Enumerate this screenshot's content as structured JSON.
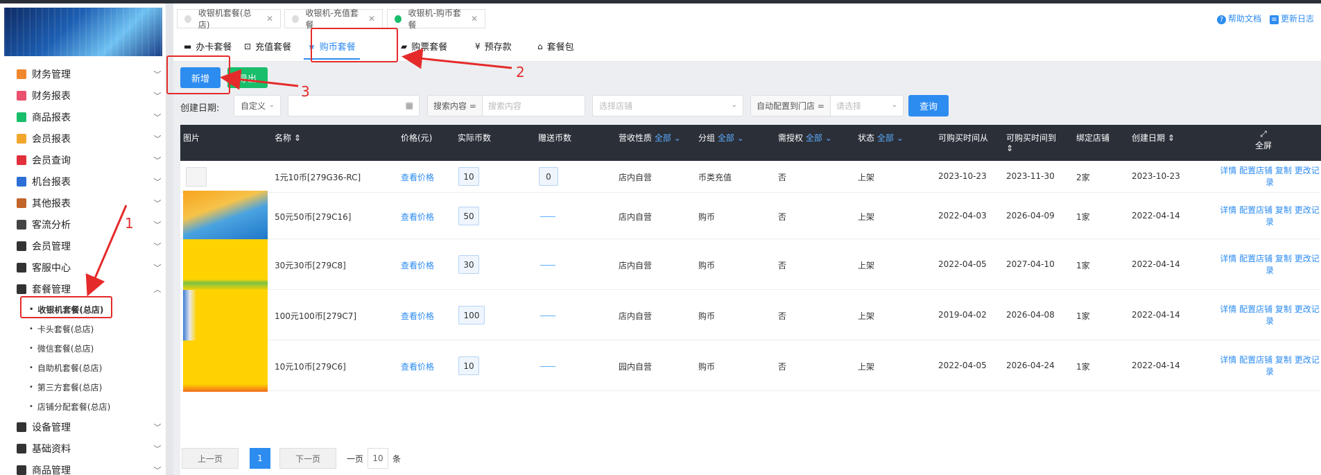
{
  "sidebar": {
    "menu": [
      {
        "label": "财务管理",
        "icon": "finance-icon",
        "color": "#f0872d",
        "expanded": false
      },
      {
        "label": "财务报表",
        "icon": "finance-report-icon",
        "color": "#e9516f",
        "expanded": false
      },
      {
        "label": "商品报表",
        "icon": "goods-report-icon",
        "color": "#19be6b",
        "expanded": false
      },
      {
        "label": "会员报表",
        "icon": "member-report-icon",
        "color": "#f2a72c",
        "expanded": false
      },
      {
        "label": "会员查询",
        "icon": "member-query-icon",
        "color": "#e0303c",
        "expanded": false
      },
      {
        "label": "机台报表",
        "icon": "machine-report-icon",
        "color": "#2d6fd6",
        "expanded": false
      },
      {
        "label": "其他报表",
        "icon": "other-report-icon",
        "color": "#c2652a",
        "expanded": false
      },
      {
        "label": "客流分析",
        "icon": "traffic-analysis-icon",
        "color": "#444",
        "expanded": false
      },
      {
        "label": "会员管理",
        "icon": "member-manage-icon",
        "color": "#333",
        "expanded": false
      },
      {
        "label": "客服中心",
        "icon": "headset-icon",
        "color": "#333",
        "expanded": false
      },
      {
        "label": "套餐管理",
        "icon": "package-manage-icon",
        "color": "#333",
        "expanded": true
      }
    ],
    "submenu": [
      "收银机套餐(总店)",
      "卡头套餐(总店)",
      "微信套餐(总店)",
      "自助机套餐(总店)",
      "第三方套餐(总店)",
      "店铺分配套餐(总店)"
    ],
    "menu_after": [
      {
        "label": "设备管理",
        "icon": "device-manage-icon",
        "color": "#333"
      },
      {
        "label": "基础资料",
        "icon": "basic-data-icon",
        "color": "#333"
      },
      {
        "label": "商品管理",
        "icon": "goods-manage-icon",
        "color": "#333"
      }
    ]
  },
  "page_tabs": [
    {
      "label": "收银机套餐(总店)",
      "active": false
    },
    {
      "label": "收银机-充值套餐",
      "active": false
    },
    {
      "label": "收银机-购币套餐",
      "active": true
    }
  ],
  "top_links": {
    "help": "帮助文档",
    "update": "更新日志"
  },
  "sub_tabs": [
    {
      "label": "办卡套餐",
      "icon": "card-icon"
    },
    {
      "label": "充值套餐",
      "icon": "recharge-icon"
    },
    {
      "label": "购币套餐",
      "icon": "star-icon"
    },
    {
      "label": "购票套餐",
      "icon": "ticket-icon"
    },
    {
      "label": "预存款",
      "icon": "yen-icon"
    },
    {
      "label": "套餐包",
      "icon": "basket-icon"
    }
  ],
  "toolbar": {
    "add": "新增",
    "export": "导出"
  },
  "filters": {
    "date_label": "创建日期:",
    "date_mode": "自定义",
    "search_prefix": "搜索内容 =",
    "search_placeholder": "搜索内容",
    "store_placeholder": "选择店铺",
    "auto_prefix": "自动配置到门店 =",
    "auto_placeholder": "请选择",
    "query": "查询"
  },
  "table": {
    "headers": {
      "image": "图片",
      "name": "名称",
      "price": "价格(元)",
      "coins": "实际币数",
      "bonus": "赠送币数",
      "revenue": "营收性质",
      "revenue_filter": "全部",
      "group": "分组",
      "group_filter": "全部",
      "auth": "需授权",
      "auth_filter": "全部",
      "status": "状态",
      "status_filter": "全部",
      "buy_from": "可购买时间从",
      "buy_to": "可购买时间到",
      "stores": "绑定店铺",
      "created": "创建日期",
      "fullscreen": "全屏"
    },
    "rows": [
      {
        "image": "placeholder",
        "name": "1元10币[279G36-RC]",
        "price": "查看价格",
        "coins": "10",
        "bonus": "0",
        "revenue": "店内自营",
        "group": "币类充值",
        "auth": "否",
        "status": "上架",
        "from": "2023-10-23",
        "to": "2023-11-30",
        "stores": "2家",
        "created": "2023-10-23"
      },
      {
        "image": "umbrella",
        "name": "50元50币[279C16]",
        "price": "查看价格",
        "coins": "50",
        "bonus": "",
        "revenue": "店内自营",
        "group": "购币",
        "auth": "否",
        "status": "上架",
        "from": "2022-04-03",
        "to": "2026-04-09",
        "stores": "1家",
        "created": "2022-04-14"
      },
      {
        "image": "yellow-grass",
        "name": "30元30币[279C8]",
        "price": "查看价格",
        "coins": "30",
        "bonus": "",
        "revenue": "店内自营",
        "group": "购币",
        "auth": "否",
        "status": "上架",
        "from": "2022-04-05",
        "to": "2027-04-10",
        "stores": "1家",
        "created": "2022-04-14"
      },
      {
        "image": "yellow-figure",
        "name": "100元100币[279C7]",
        "price": "查看价格",
        "coins": "100",
        "bonus": "",
        "revenue": "店内自营",
        "group": "购币",
        "auth": "否",
        "status": "上架",
        "from": "2019-04-02",
        "to": "2026-04-08",
        "stores": "1家",
        "created": "2022-04-14"
      },
      {
        "image": "yellow-flower",
        "name": "10元10币[279C6]",
        "price": "查看价格",
        "coins": "10",
        "bonus": "",
        "revenue": "园内自营",
        "group": "购币",
        "auth": "否",
        "status": "上架",
        "from": "2022-04-05",
        "to": "2026-04-24",
        "stores": "1家",
        "created": "2022-04-14"
      }
    ],
    "ops": {
      "detail": "详情",
      "config": "配置店铺",
      "copy": "复制",
      "log": "更改记录"
    }
  },
  "pager": {
    "prev": "上一页",
    "current": "1",
    "next": "下一页",
    "size_label": "一页",
    "size": "10",
    "unit": "条"
  },
  "annotations": [
    "1",
    "2",
    "3"
  ]
}
